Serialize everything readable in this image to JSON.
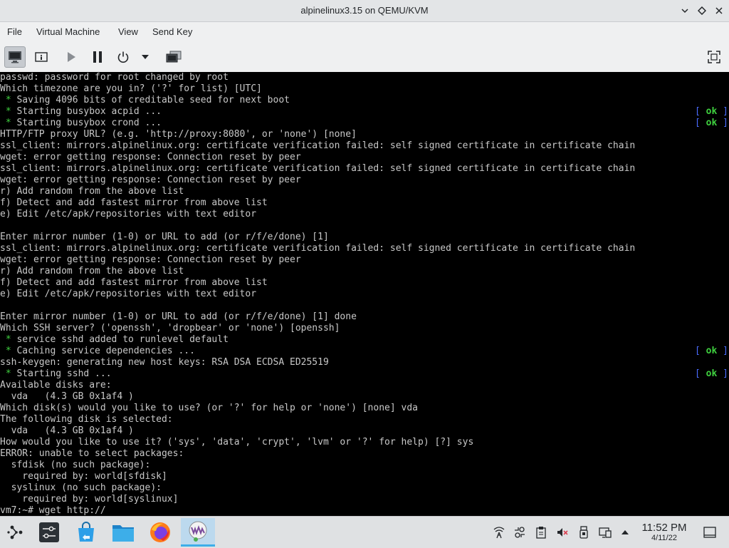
{
  "window": {
    "title": "alpinelinux3.15 on QEMU/KVM"
  },
  "menu": [
    "File",
    "Virtual Machine",
    "View",
    "Send Key"
  ],
  "console": {
    "lines": [
      {
        "text": "passwd: password for root changed by root"
      },
      {
        "text": "Which timezone are you in? ('?' for list) [UTC]"
      },
      {
        "star": true,
        "text": " Saving 4096 bits of creditable seed for next boot"
      },
      {
        "star": true,
        "text": " Starting busybox acpid ...",
        "status": "ok"
      },
      {
        "star": true,
        "text": " Starting busybox crond ...",
        "status": "ok"
      },
      {
        "text": "HTTP/FTP proxy URL? (e.g. 'http://proxy:8080', or 'none') [none]"
      },
      {
        "text": "ssl_client: mirrors.alpinelinux.org: certificate verification failed: self signed certificate in certificate chain"
      },
      {
        "text": "wget: error getting response: Connection reset by peer"
      },
      {
        "text": "ssl_client: mirrors.alpinelinux.org: certificate verification failed: self signed certificate in certificate chain"
      },
      {
        "text": "wget: error getting response: Connection reset by peer"
      },
      {
        "text": "r) Add random from the above list"
      },
      {
        "text": "f) Detect and add fastest mirror from above list"
      },
      {
        "text": "e) Edit /etc/apk/repositories with text editor"
      },
      {
        "text": ""
      },
      {
        "text": "Enter mirror number (1-0) or URL to add (or r/f/e/done) [1]"
      },
      {
        "text": "ssl_client: mirrors.alpinelinux.org: certificate verification failed: self signed certificate in certificate chain"
      },
      {
        "text": "wget: error getting response: Connection reset by peer"
      },
      {
        "text": "r) Add random from the above list"
      },
      {
        "text": "f) Detect and add fastest mirror from above list"
      },
      {
        "text": "e) Edit /etc/apk/repositories with text editor"
      },
      {
        "text": ""
      },
      {
        "text": "Enter mirror number (1-0) or URL to add (or r/f/e/done) [1] done"
      },
      {
        "text": "Which SSH server? ('openssh', 'dropbear' or 'none') [openssh]"
      },
      {
        "star": true,
        "text": " service sshd added to runlevel default"
      },
      {
        "star": true,
        "text": " Caching service dependencies ...",
        "status": "ok"
      },
      {
        "text": "ssh-keygen: generating new host keys: RSA DSA ECDSA ED25519"
      },
      {
        "star": true,
        "text": " Starting sshd ...",
        "status": "ok"
      },
      {
        "text": "Available disks are:"
      },
      {
        "text": "  vda   (4.3 GB 0x1af4 )"
      },
      {
        "text": "Which disk(s) would you like to use? (or '?' for help or 'none') [none] vda"
      },
      {
        "text": "The following disk is selected:"
      },
      {
        "text": "  vda   (4.3 GB 0x1af4 )"
      },
      {
        "text": "How would you like to use it? ('sys', 'data', 'crypt', 'lvm' or '?' for help) [?] sys"
      },
      {
        "text": "ERROR: unable to select packages:"
      },
      {
        "text": "  sfdisk (no such package):"
      },
      {
        "text": "    required by: world[sfdisk]"
      },
      {
        "text": "  syslinux (no such package):"
      },
      {
        "text": "    required by: world[syslinux]"
      },
      {
        "text": "vm7:~# wget http://"
      }
    ]
  },
  "clock": {
    "time": "11:52 PM",
    "date": "4/11/22"
  }
}
